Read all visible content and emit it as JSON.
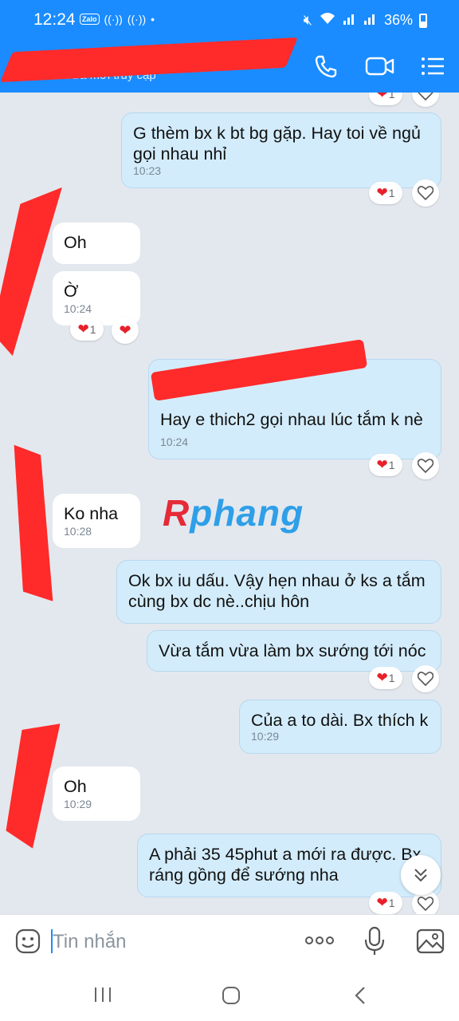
{
  "status_bar": {
    "time": "12:24",
    "app_badge": "Zalo",
    "battery": "36%"
  },
  "header": {
    "subtitle": "Vừa mới truy cập",
    "icons": [
      "back-icon",
      "phone-icon",
      "video-call-icon",
      "menu-icon"
    ],
    "accent": "#1a8cff"
  },
  "messages": [
    {
      "dir": "out",
      "text": "G thèm bx k bt bg gặp. Hay toi về ngủ gọi nhau nhỉ",
      "time": "10:23",
      "reaction_count": "1"
    },
    {
      "dir": "in",
      "text": "Oh",
      "time": ""
    },
    {
      "dir": "in",
      "text": "Ờ",
      "time": "10:24",
      "reaction_count": "1"
    },
    {
      "dir": "out",
      "text": "Hay e thich2 gọi nhau lúc tắm k nè",
      "time": "10:24",
      "reaction_count": "1"
    },
    {
      "dir": "in",
      "text": "Ko nha",
      "time": "10:28"
    },
    {
      "dir": "out",
      "text": "Ok bx iu dấu. Vậy hẹn nhau ở ks a tắm cùng bx dc nè..chịu hôn",
      "time": ""
    },
    {
      "dir": "out",
      "text": "Vừa tắm vừa làm bx sướng tới nóc",
      "time": "",
      "reaction_count": "1"
    },
    {
      "dir": "out",
      "text": "Của a to dài. Bx thích k",
      "time": "10:29"
    },
    {
      "dir": "in",
      "text": "Oh",
      "time": "10:29"
    },
    {
      "dir": "out",
      "text": "A phải 35 45phut a mới ra được. Bx ráng gồng để sướng nha",
      "time": "",
      "reaction_count": "1"
    }
  ],
  "top_partial_reaction": "1",
  "watermark": {
    "part1": "R",
    "part2": "phang"
  },
  "input": {
    "placeholder": "Tin nhắn"
  },
  "colors": {
    "outgoing_bubble": "#d3ecfb",
    "incoming_bubble": "#ffffff",
    "heart": "#e8202a",
    "redaction": "#ff2a2a"
  }
}
